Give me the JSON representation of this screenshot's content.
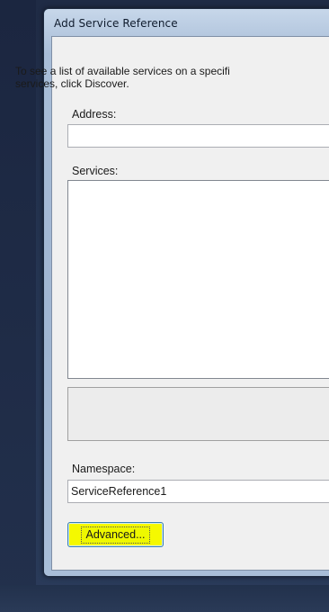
{
  "window": {
    "title": "Add Service Reference"
  },
  "dialog": {
    "description": "To see a list of available services on a specifi\nservices, click Discover.",
    "address": {
      "label": "Address:",
      "value": ""
    },
    "services": {
      "label": "Services:"
    },
    "namespace": {
      "label": "Namespace:",
      "value": "ServiceReference1"
    },
    "advanced_button_label": "Advanced..."
  },
  "colors": {
    "highlight": "#f5f900",
    "desktop": "#253552",
    "client_background": "#f0f0f0"
  }
}
